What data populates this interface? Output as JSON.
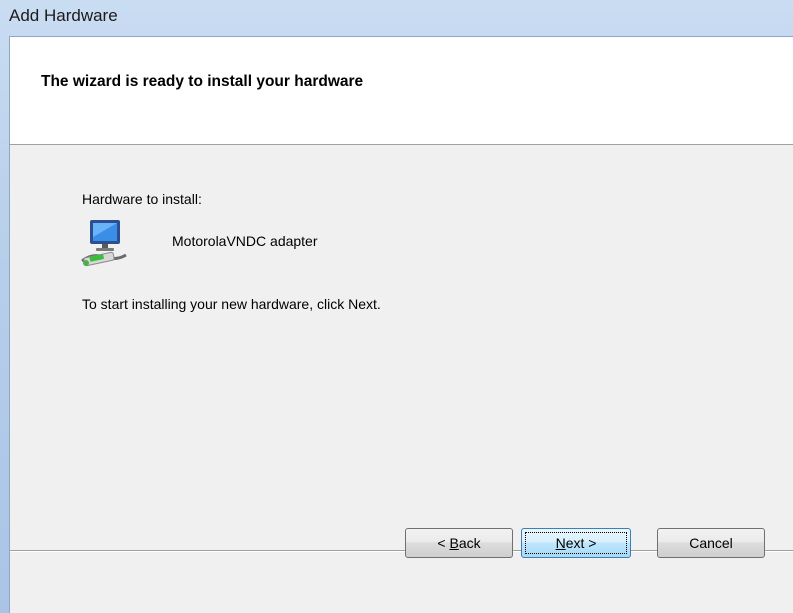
{
  "window": {
    "title": "Add Hardware"
  },
  "header": {
    "title": "The wizard is ready to install your hardware"
  },
  "content": {
    "hardware_label": "Hardware to install:",
    "device_name": "MotorolaVNDC adapter",
    "device_icon": "network-adapter-icon",
    "instruction": "To start installing your new hardware, click Next."
  },
  "buttons": {
    "back": {
      "prefix": "< ",
      "mnemonic": "B",
      "suffix": "ack"
    },
    "next": {
      "prefix": "",
      "mnemonic": "N",
      "suffix": "ext >"
    },
    "cancel": {
      "label": "Cancel"
    }
  }
}
